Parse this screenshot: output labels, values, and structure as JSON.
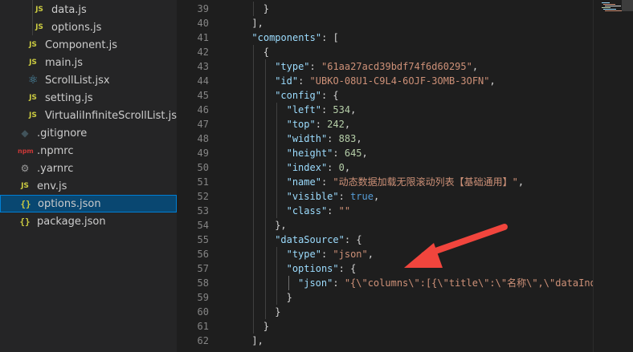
{
  "explorer": {
    "items": [
      {
        "name": "data.js",
        "icon": "js-icon",
        "icon_text": "JS",
        "indent": 1
      },
      {
        "name": "options.js",
        "icon": "js-icon",
        "icon_text": "JS",
        "indent": 1
      },
      {
        "name": "Component.js",
        "icon": "js-icon",
        "icon_text": "JS",
        "indent": 0
      },
      {
        "name": "main.js",
        "icon": "js-icon",
        "icon_text": "JS",
        "indent": 0
      },
      {
        "name": "ScrollList.jsx",
        "icon": "react-icon",
        "icon_text": "⚛",
        "indent": 0
      },
      {
        "name": "setting.js",
        "icon": "js-icon",
        "icon_text": "JS",
        "indent": 0
      },
      {
        "name": "VirtualiInfiniteScrollList.js",
        "icon": "js-icon",
        "icon_text": "JS",
        "indent": 0
      },
      {
        "name": ".gitignore",
        "icon": "git-icon",
        "icon_text": "◆",
        "indent": -1
      },
      {
        "name": ".npmrc",
        "icon": "npm-icon",
        "icon_text": "npm",
        "indent": -1
      },
      {
        "name": ".yarnrc",
        "icon": "yarn-icon",
        "icon_text": "⚙",
        "indent": -1
      },
      {
        "name": "env.js",
        "icon": "js-icon",
        "icon_text": "JS",
        "indent": -1
      },
      {
        "name": "options.json",
        "icon": "json-icon",
        "icon_text": "{}",
        "indent": -1,
        "selected": true
      },
      {
        "name": "package.json",
        "icon": "json-icon",
        "icon_text": "{}",
        "indent": -1
      }
    ]
  },
  "editor": {
    "lines": [
      {
        "num": "39",
        "indent": 2,
        "tokens": [
          [
            "p",
            "}"
          ]
        ]
      },
      {
        "num": "40",
        "indent": 1,
        "tokens": [
          [
            "p",
            "],"
          ]
        ]
      },
      {
        "num": "41",
        "indent": 1,
        "tokens": [
          [
            "k",
            "\"components\""
          ],
          [
            "p",
            ": ["
          ]
        ]
      },
      {
        "num": "42",
        "indent": 2,
        "tokens": [
          [
            "p",
            "{"
          ]
        ]
      },
      {
        "num": "43",
        "indent": 3,
        "tokens": [
          [
            "k",
            "\"type\""
          ],
          [
            "p",
            ": "
          ],
          [
            "s",
            "\"61aa27acd39bdf74f6d60295\""
          ],
          [
            "p",
            ","
          ]
        ]
      },
      {
        "num": "44",
        "indent": 3,
        "tokens": [
          [
            "k",
            "\"id\""
          ],
          [
            "p",
            ": "
          ],
          [
            "s",
            "\"UBKO-08U1-C9L4-6OJF-3OMB-3OFN\""
          ],
          [
            "p",
            ","
          ]
        ]
      },
      {
        "num": "45",
        "indent": 3,
        "tokens": [
          [
            "k",
            "\"config\""
          ],
          [
            "p",
            ": {"
          ]
        ]
      },
      {
        "num": "46",
        "indent": 4,
        "tokens": [
          [
            "k",
            "\"left\""
          ],
          [
            "p",
            ": "
          ],
          [
            "n",
            "534"
          ],
          [
            "p",
            ","
          ]
        ]
      },
      {
        "num": "47",
        "indent": 4,
        "tokens": [
          [
            "k",
            "\"top\""
          ],
          [
            "p",
            ": "
          ],
          [
            "n",
            "242"
          ],
          [
            "p",
            ","
          ]
        ]
      },
      {
        "num": "48",
        "indent": 4,
        "tokens": [
          [
            "k",
            "\"width\""
          ],
          [
            "p",
            ": "
          ],
          [
            "n",
            "883"
          ],
          [
            "p",
            ","
          ]
        ]
      },
      {
        "num": "49",
        "indent": 4,
        "tokens": [
          [
            "k",
            "\"height\""
          ],
          [
            "p",
            ": "
          ],
          [
            "n",
            "645"
          ],
          [
            "p",
            ","
          ]
        ]
      },
      {
        "num": "50",
        "indent": 4,
        "tokens": [
          [
            "k",
            "\"index\""
          ],
          [
            "p",
            ": "
          ],
          [
            "n",
            "0"
          ],
          [
            "p",
            ","
          ]
        ]
      },
      {
        "num": "51",
        "indent": 4,
        "tokens": [
          [
            "k",
            "\"name\""
          ],
          [
            "p",
            ": "
          ],
          [
            "s",
            "\"动态数据加载无限滚动列表【基础通用】\""
          ],
          [
            "p",
            ","
          ]
        ]
      },
      {
        "num": "52",
        "indent": 4,
        "tokens": [
          [
            "k",
            "\"visible\""
          ],
          [
            "p",
            ": "
          ],
          [
            "b",
            "true"
          ],
          [
            "p",
            ","
          ]
        ]
      },
      {
        "num": "53",
        "indent": 4,
        "tokens": [
          [
            "k",
            "\"class\""
          ],
          [
            "p",
            ": "
          ],
          [
            "s",
            "\"\""
          ]
        ]
      },
      {
        "num": "54",
        "indent": 3,
        "tokens": [
          [
            "p",
            "},"
          ]
        ]
      },
      {
        "num": "55",
        "indent": 3,
        "tokens": [
          [
            "k",
            "\"dataSource\""
          ],
          [
            "p",
            ": {"
          ]
        ]
      },
      {
        "num": "56",
        "indent": 4,
        "tokens": [
          [
            "k",
            "\"type\""
          ],
          [
            "p",
            ": "
          ],
          [
            "s",
            "\"json\""
          ],
          [
            "p",
            ","
          ]
        ]
      },
      {
        "num": "57",
        "indent": 4,
        "tokens": [
          [
            "k",
            "\"options\""
          ],
          [
            "p",
            ": {"
          ]
        ]
      },
      {
        "num": "58",
        "indent": 5,
        "tokens": [
          [
            "k",
            "\"json\""
          ],
          [
            "p",
            ": "
          ],
          [
            "s",
            "\"{\\\"columns\\\":[{\\\"title\\\":\\\"名称\\\",\\\"dataIndex"
          ]
        ]
      },
      {
        "num": "59",
        "indent": 4,
        "tokens": [
          [
            "p",
            "}"
          ]
        ]
      },
      {
        "num": "60",
        "indent": 3,
        "tokens": [
          [
            "p",
            "}"
          ]
        ]
      },
      {
        "num": "61",
        "indent": 2,
        "tokens": [
          [
            "p",
            "}"
          ]
        ]
      },
      {
        "num": "62",
        "indent": 1,
        "tokens": [
          [
            "p",
            "],"
          ]
        ]
      }
    ]
  },
  "annotation": {
    "arrow_color": "#f1453d"
  },
  "colors": {
    "key": "#9cdcfe",
    "string": "#ce9178",
    "number": "#b5cea8",
    "boolean": "#569cd6",
    "punct": "#d4d4d4",
    "selection_bg": "#094771",
    "selection_border": "#007fd4"
  }
}
